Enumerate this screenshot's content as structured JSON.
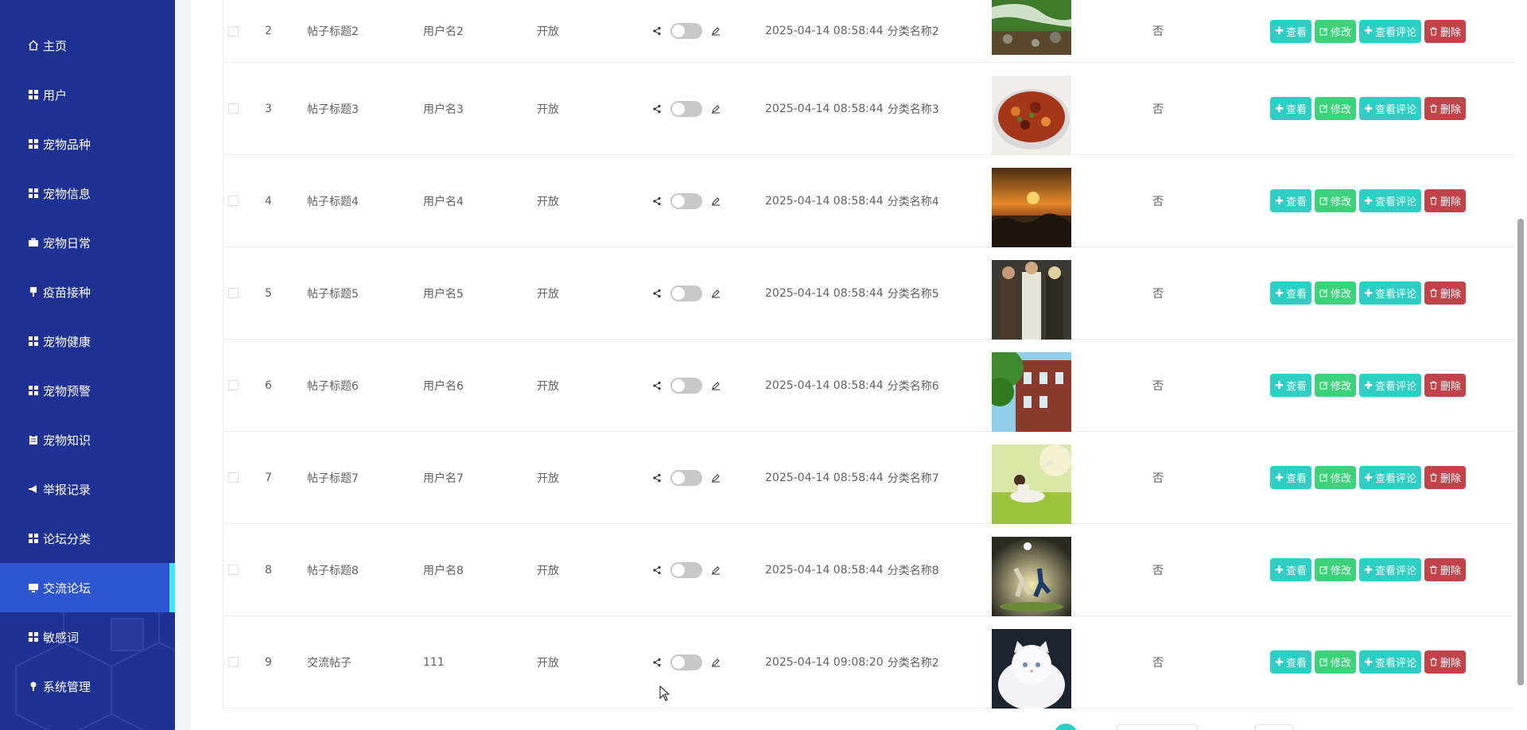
{
  "sidebar": {
    "items": [
      {
        "label": "主页",
        "icon": "home-icon",
        "active": false
      },
      {
        "label": "用户",
        "icon": "grid-icon",
        "active": false
      },
      {
        "label": "宠物品种",
        "icon": "grid-icon",
        "active": false
      },
      {
        "label": "宠物信息",
        "icon": "grid-icon",
        "active": false
      },
      {
        "label": "宠物日常",
        "icon": "briefcase-icon",
        "active": false
      },
      {
        "label": "疫苗接种",
        "icon": "syringe-icon",
        "active": false
      },
      {
        "label": "宠物健康",
        "icon": "grid-icon",
        "active": false
      },
      {
        "label": "宠物预警",
        "icon": "grid-icon",
        "active": false
      },
      {
        "label": "宠物知识",
        "icon": "clipboard-icon",
        "active": false
      },
      {
        "label": "举报记录",
        "icon": "megaphone-icon",
        "active": false
      },
      {
        "label": "论坛分类",
        "icon": "grid-icon",
        "active": false
      },
      {
        "label": "交流论坛",
        "icon": "monitor-icon",
        "active": true
      },
      {
        "label": "敏感词",
        "icon": "grid-icon",
        "active": false
      },
      {
        "label": "系统管理",
        "icon": "pin-icon",
        "active": false
      }
    ]
  },
  "table": {
    "rows": [
      {
        "index": "2",
        "title": "帖子标题2",
        "user": "用户名2",
        "state": "开放",
        "time": "2025-04-14 08:58:44",
        "category": "分类名称2",
        "flag": "否",
        "image": "river-landscape"
      },
      {
        "index": "3",
        "title": "帖子标题3",
        "user": "用户名3",
        "state": "开放",
        "time": "2025-04-14 08:58:44",
        "category": "分类名称3",
        "flag": "否",
        "image": "food-plate"
      },
      {
        "index": "4",
        "title": "帖子标题4",
        "user": "用户名4",
        "state": "开放",
        "time": "2025-04-14 08:58:44",
        "category": "分类名称4",
        "flag": "否",
        "image": "sunset-sea"
      },
      {
        "index": "5",
        "title": "帖子标题5",
        "user": "用户名5",
        "state": "开放",
        "time": "2025-04-14 08:58:44",
        "category": "分类名称5",
        "flag": "否",
        "image": "three-people"
      },
      {
        "index": "6",
        "title": "帖子标题6",
        "user": "用户名6",
        "state": "开放",
        "time": "2025-04-14 08:58:44",
        "category": "分类名称6",
        "flag": "否",
        "image": "brick-building"
      },
      {
        "index": "7",
        "title": "帖子标题7",
        "user": "用户名7",
        "state": "开放",
        "time": "2025-04-14 08:58:44",
        "category": "分类名称7",
        "flag": "否",
        "image": "girl-on-grass"
      },
      {
        "index": "8",
        "title": "帖子标题8",
        "user": "用户名8",
        "state": "开放",
        "time": "2025-04-14 08:58:44",
        "category": "分类名称8",
        "flag": "否",
        "image": "soccer-players"
      },
      {
        "index": "9",
        "title": "交流帖子",
        "user": "111",
        "state": "开放",
        "time": "2025-04-14 09:08:20",
        "category": "分类名称2",
        "flag": "否",
        "image": "white-cat"
      }
    ],
    "actions": {
      "view": "查看",
      "edit": "修改",
      "comments": "查看评论",
      "delete": "删除"
    }
  },
  "colors": {
    "sidebar_bg": "#1f3193",
    "sidebar_active": "#2f56d1",
    "active_marker": "#45e4ff",
    "view_btn": "#2dcfc4",
    "edit_btn": "#3cd27b",
    "delete_btn": "#c3434b"
  }
}
